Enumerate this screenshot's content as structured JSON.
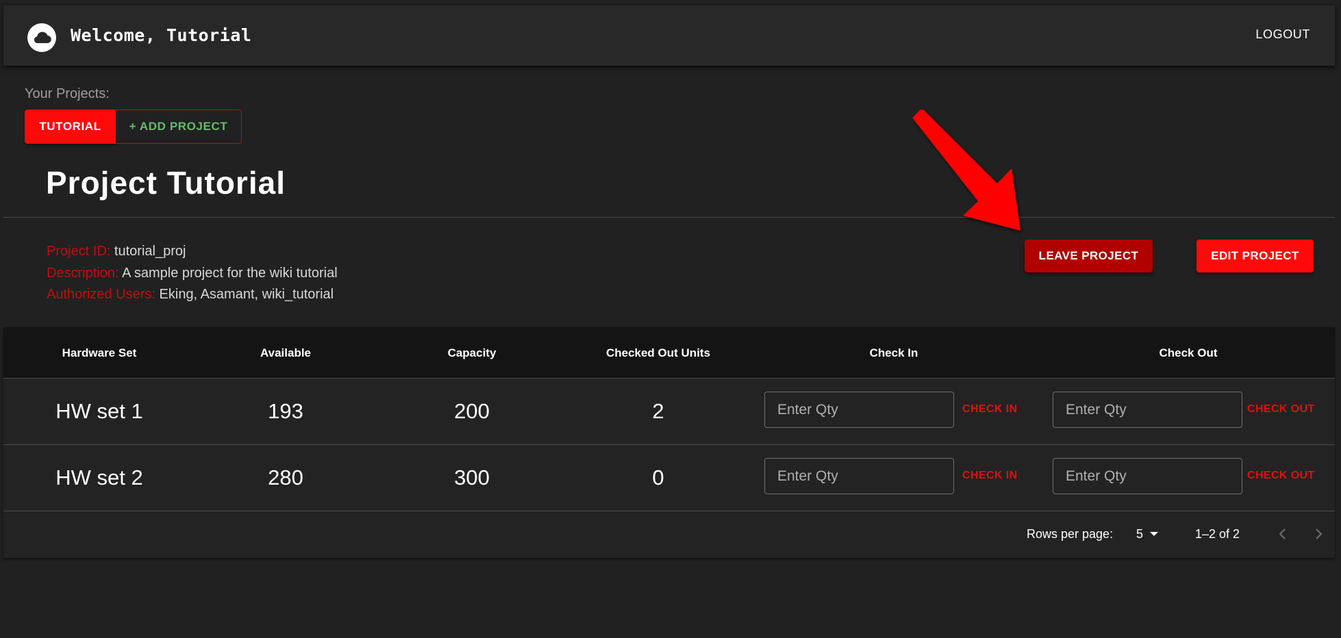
{
  "header": {
    "title": "Welcome, Tutorial",
    "logout_label": "LOGOUT",
    "logo_icon": "cloud-icon"
  },
  "projects": {
    "label": "Your Projects:",
    "tabs": [
      {
        "label": "TUTORIAL",
        "active": true
      }
    ],
    "add_label": "+ ADD PROJECT"
  },
  "project": {
    "title": "Project Tutorial",
    "fields": [
      {
        "key": "Project ID:",
        "value": "tutorial_proj"
      },
      {
        "key": "Description:",
        "value": "A sample project for the wiki tutorial"
      },
      {
        "key": "Authorized Users:",
        "value": "Eking, Asamant, wiki_tutorial"
      }
    ],
    "leave_label": "LEAVE PROJECT",
    "edit_label": "EDIT PROJECT"
  },
  "table": {
    "columns": [
      "Hardware Set",
      "Available",
      "Capacity",
      "Checked Out Units",
      "Check In",
      "Check Out"
    ],
    "rows": [
      {
        "name": "HW set 1",
        "available": "193",
        "capacity": "200",
        "checked_out": "2"
      },
      {
        "name": "HW set 2",
        "available": "280",
        "capacity": "300",
        "checked_out": "0"
      }
    ],
    "qty_placeholder": "Enter Qty",
    "check_in_label": "CHECK IN",
    "check_out_label": "CHECK OUT",
    "rows_per_page_label": "Rows per page:",
    "rows_per_page_value": "5",
    "range_text": "1–2 of 2"
  },
  "colors": {
    "background": "#212121",
    "appbar": "#282828",
    "primary_red": "#ff0a0a",
    "dark_red": "#b00000",
    "label_red": "#c30d0d",
    "add_green": "#66bb6a",
    "table_header": "#141414"
  }
}
